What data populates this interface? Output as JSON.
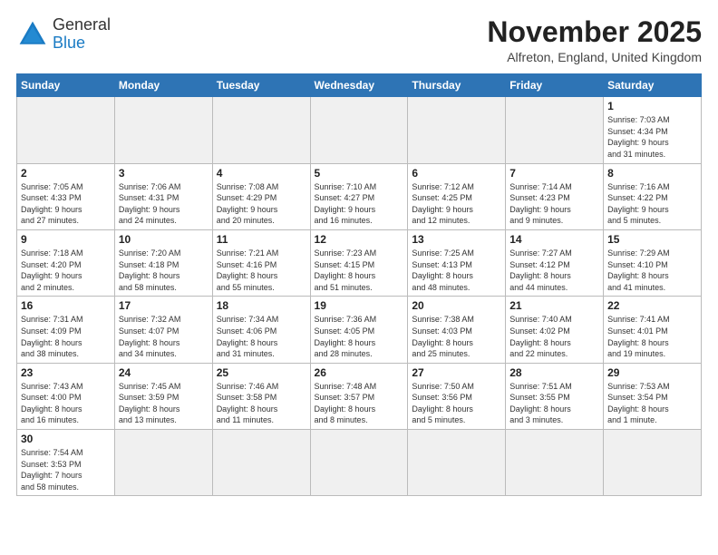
{
  "header": {
    "logo_line1": "General",
    "logo_line2": "Blue",
    "month_title": "November 2025",
    "location": "Alfreton, England, United Kingdom"
  },
  "days_of_week": [
    "Sunday",
    "Monday",
    "Tuesday",
    "Wednesday",
    "Thursday",
    "Friday",
    "Saturday"
  ],
  "weeks": [
    [
      {
        "day": "",
        "info": ""
      },
      {
        "day": "",
        "info": ""
      },
      {
        "day": "",
        "info": ""
      },
      {
        "day": "",
        "info": ""
      },
      {
        "day": "",
        "info": ""
      },
      {
        "day": "",
        "info": ""
      },
      {
        "day": "1",
        "info": "Sunrise: 7:03 AM\nSunset: 4:34 PM\nDaylight: 9 hours\nand 31 minutes."
      }
    ],
    [
      {
        "day": "2",
        "info": "Sunrise: 7:05 AM\nSunset: 4:33 PM\nDaylight: 9 hours\nand 27 minutes."
      },
      {
        "day": "3",
        "info": "Sunrise: 7:06 AM\nSunset: 4:31 PM\nDaylight: 9 hours\nand 24 minutes."
      },
      {
        "day": "4",
        "info": "Sunrise: 7:08 AM\nSunset: 4:29 PM\nDaylight: 9 hours\nand 20 minutes."
      },
      {
        "day": "5",
        "info": "Sunrise: 7:10 AM\nSunset: 4:27 PM\nDaylight: 9 hours\nand 16 minutes."
      },
      {
        "day": "6",
        "info": "Sunrise: 7:12 AM\nSunset: 4:25 PM\nDaylight: 9 hours\nand 12 minutes."
      },
      {
        "day": "7",
        "info": "Sunrise: 7:14 AM\nSunset: 4:23 PM\nDaylight: 9 hours\nand 9 minutes."
      },
      {
        "day": "8",
        "info": "Sunrise: 7:16 AM\nSunset: 4:22 PM\nDaylight: 9 hours\nand 5 minutes."
      }
    ],
    [
      {
        "day": "9",
        "info": "Sunrise: 7:18 AM\nSunset: 4:20 PM\nDaylight: 9 hours\nand 2 minutes."
      },
      {
        "day": "10",
        "info": "Sunrise: 7:20 AM\nSunset: 4:18 PM\nDaylight: 8 hours\nand 58 minutes."
      },
      {
        "day": "11",
        "info": "Sunrise: 7:21 AM\nSunset: 4:16 PM\nDaylight: 8 hours\nand 55 minutes."
      },
      {
        "day": "12",
        "info": "Sunrise: 7:23 AM\nSunset: 4:15 PM\nDaylight: 8 hours\nand 51 minutes."
      },
      {
        "day": "13",
        "info": "Sunrise: 7:25 AM\nSunset: 4:13 PM\nDaylight: 8 hours\nand 48 minutes."
      },
      {
        "day": "14",
        "info": "Sunrise: 7:27 AM\nSunset: 4:12 PM\nDaylight: 8 hours\nand 44 minutes."
      },
      {
        "day": "15",
        "info": "Sunrise: 7:29 AM\nSunset: 4:10 PM\nDaylight: 8 hours\nand 41 minutes."
      }
    ],
    [
      {
        "day": "16",
        "info": "Sunrise: 7:31 AM\nSunset: 4:09 PM\nDaylight: 8 hours\nand 38 minutes."
      },
      {
        "day": "17",
        "info": "Sunrise: 7:32 AM\nSunset: 4:07 PM\nDaylight: 8 hours\nand 34 minutes."
      },
      {
        "day": "18",
        "info": "Sunrise: 7:34 AM\nSunset: 4:06 PM\nDaylight: 8 hours\nand 31 minutes."
      },
      {
        "day": "19",
        "info": "Sunrise: 7:36 AM\nSunset: 4:05 PM\nDaylight: 8 hours\nand 28 minutes."
      },
      {
        "day": "20",
        "info": "Sunrise: 7:38 AM\nSunset: 4:03 PM\nDaylight: 8 hours\nand 25 minutes."
      },
      {
        "day": "21",
        "info": "Sunrise: 7:40 AM\nSunset: 4:02 PM\nDaylight: 8 hours\nand 22 minutes."
      },
      {
        "day": "22",
        "info": "Sunrise: 7:41 AM\nSunset: 4:01 PM\nDaylight: 8 hours\nand 19 minutes."
      }
    ],
    [
      {
        "day": "23",
        "info": "Sunrise: 7:43 AM\nSunset: 4:00 PM\nDaylight: 8 hours\nand 16 minutes."
      },
      {
        "day": "24",
        "info": "Sunrise: 7:45 AM\nSunset: 3:59 PM\nDaylight: 8 hours\nand 13 minutes."
      },
      {
        "day": "25",
        "info": "Sunrise: 7:46 AM\nSunset: 3:58 PM\nDaylight: 8 hours\nand 11 minutes."
      },
      {
        "day": "26",
        "info": "Sunrise: 7:48 AM\nSunset: 3:57 PM\nDaylight: 8 hours\nand 8 minutes."
      },
      {
        "day": "27",
        "info": "Sunrise: 7:50 AM\nSunset: 3:56 PM\nDaylight: 8 hours\nand 5 minutes."
      },
      {
        "day": "28",
        "info": "Sunrise: 7:51 AM\nSunset: 3:55 PM\nDaylight: 8 hours\nand 3 minutes."
      },
      {
        "day": "29",
        "info": "Sunrise: 7:53 AM\nSunset: 3:54 PM\nDaylight: 8 hours\nand 1 minute."
      }
    ],
    [
      {
        "day": "30",
        "info": "Sunrise: 7:54 AM\nSunset: 3:53 PM\nDaylight: 7 hours\nand 58 minutes."
      },
      {
        "day": "",
        "info": ""
      },
      {
        "day": "",
        "info": ""
      },
      {
        "day": "",
        "info": ""
      },
      {
        "day": "",
        "info": ""
      },
      {
        "day": "",
        "info": ""
      },
      {
        "day": "",
        "info": ""
      }
    ]
  ]
}
